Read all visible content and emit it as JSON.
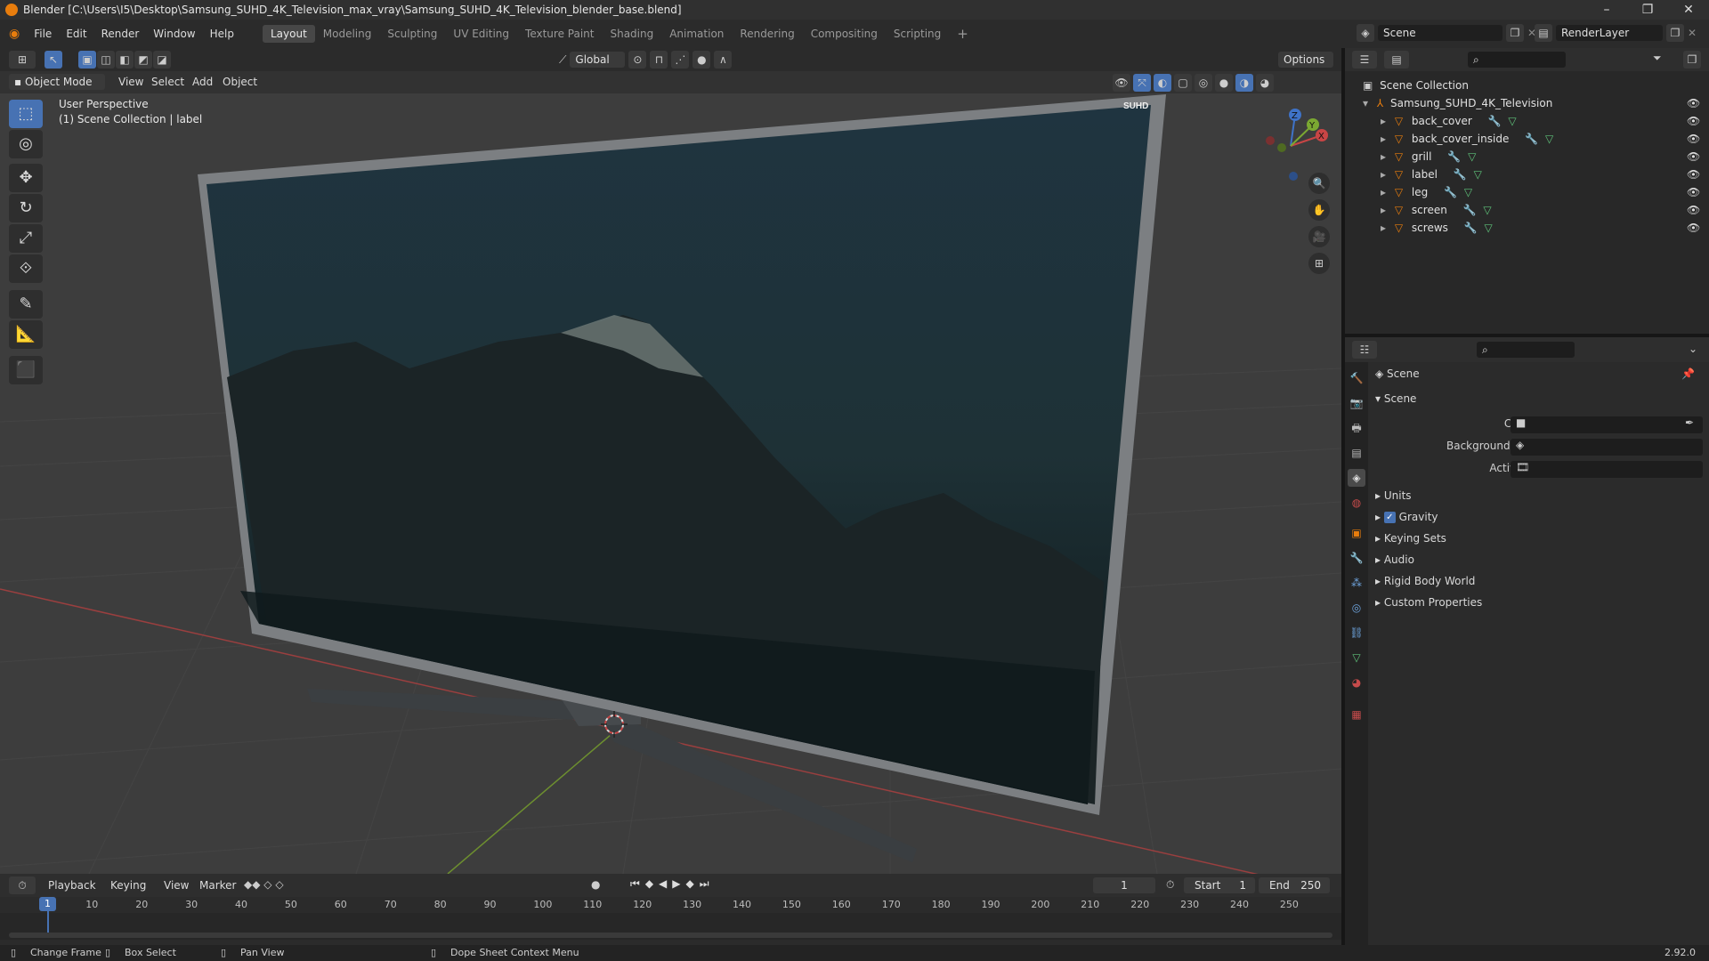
{
  "window": {
    "title": "Blender [C:\\Users\\I5\\Desktop\\Samsung_SUHD_4K_Television_max_vray\\Samsung_SUHD_4K_Television_blender_base.blend]",
    "minimize": "–",
    "maximize": "❐",
    "close": "✕"
  },
  "menu": [
    "File",
    "Edit",
    "Render",
    "Window",
    "Help"
  ],
  "workspaces": [
    "Layout",
    "Modeling",
    "Sculpting",
    "UV Editing",
    "Texture Paint",
    "Shading",
    "Animation",
    "Rendering",
    "Compositing",
    "Scripting"
  ],
  "active_workspace": "Layout",
  "scene_selector": {
    "scene": "Scene",
    "view_layer": "RenderLayer"
  },
  "viewport": {
    "transform_orientation": "Global",
    "options_label": "Options",
    "mode": "Object Mode",
    "header_menu": [
      "View",
      "Select",
      "Add",
      "Object"
    ],
    "overlay_line1": "User Perspective",
    "overlay_line2": "(1) Scene Collection | label",
    "screen_logo": "SUHD",
    "gizmo_axes": {
      "x": "X",
      "y": "Y",
      "z": "Z"
    }
  },
  "outliner": {
    "root": "Scene Collection",
    "collection": "Samsung_SUHD_4K_Television",
    "objects": [
      "back_cover",
      "back_cover_inside",
      "grill",
      "label",
      "leg",
      "screen",
      "screws"
    ]
  },
  "properties": {
    "context": "Scene",
    "panel_title": "Scene",
    "fields": {
      "camera_label": "Camera",
      "background_scene_label": "Background Scene",
      "active_clip_label": "Active Clip"
    },
    "subpanels": [
      "Units",
      "Gravity",
      "Keying Sets",
      "Audio",
      "Rigid Body World",
      "Custom Properties"
    ],
    "gravity_checked": true
  },
  "timeline": {
    "menus": [
      "Playback",
      "Keying",
      "View",
      "Marker"
    ],
    "current_frame": "1",
    "start_label": "Start",
    "start_value": "1",
    "end_label": "End",
    "end_value": "250",
    "ruler": [
      "1",
      "10",
      "20",
      "30",
      "40",
      "50",
      "60",
      "70",
      "80",
      "90",
      "100",
      "110",
      "120",
      "130",
      "140",
      "150",
      "160",
      "170",
      "180",
      "190",
      "200",
      "210",
      "220",
      "230",
      "240",
      "250"
    ]
  },
  "statusbar": {
    "items": [
      "Change Frame",
      "Box Select",
      "Pan View",
      "Dope Sheet Context Menu"
    ],
    "version": "2.92.0"
  },
  "colors": {
    "accent": "#4772b3",
    "blender_orange": "#e87d0d",
    "x_axis": "#c84545",
    "y_axis": "#7ba832",
    "z_axis": "#3f73c8"
  }
}
